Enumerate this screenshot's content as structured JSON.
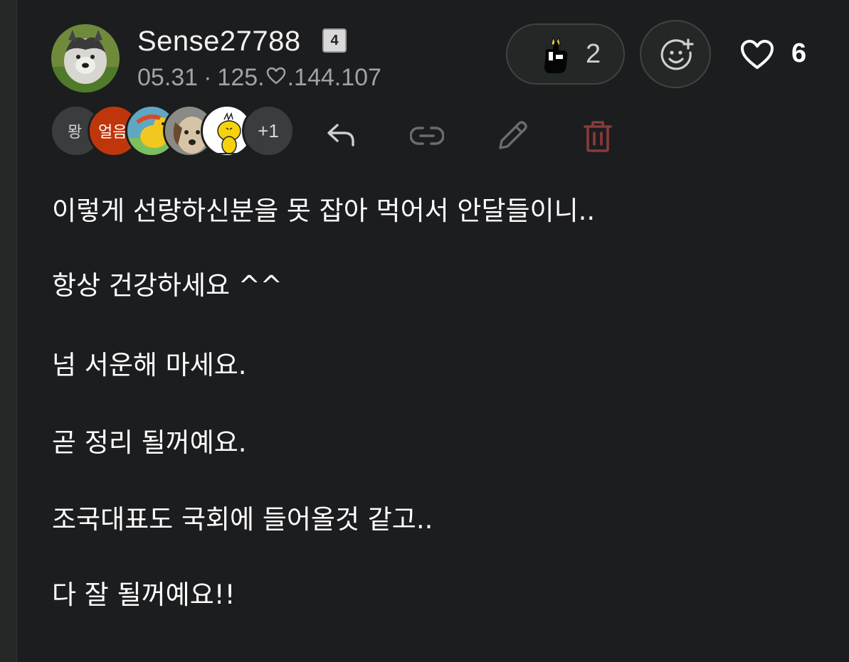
{
  "author": {
    "username": "Sense27788",
    "level": "4",
    "date": "05.31",
    "separator": "·",
    "ip_prefix": "125.",
    "ip_suffix": ".144.107",
    "avatar_icon": "husky-dog-avatar"
  },
  "reactions": {
    "emoji_icon": "thumbs-up-emoji",
    "count": "2",
    "add_icon": "smiley-plus-icon"
  },
  "likes": {
    "icon": "heart-icon",
    "count": "6"
  },
  "reactors": {
    "first_label": "뫙",
    "second_label": "얼음",
    "more_label": "+1"
  },
  "actions": {
    "reply_icon": "reply-icon",
    "link_icon": "link-icon",
    "edit_icon": "pencil-icon",
    "delete_icon": "trash-icon"
  },
  "comment": {
    "lines": [
      "이렇게 선량하신분을 못 잡아 먹어서 안달들이니..",
      "항상 건강하세요 ^^",
      "넘 서운해 마세요.",
      "곧 정리 될꺼예요.",
      "조국대표도 국회에 들어올것 같고..",
      "다 잘 될꺼예요!!"
    ]
  },
  "colors": {
    "background": "#1c1d1f",
    "text": "#ffffff",
    "meta_text": "#a3a3a3",
    "delete_red": "#8a3a3a",
    "pill_border": "#3f4442"
  }
}
